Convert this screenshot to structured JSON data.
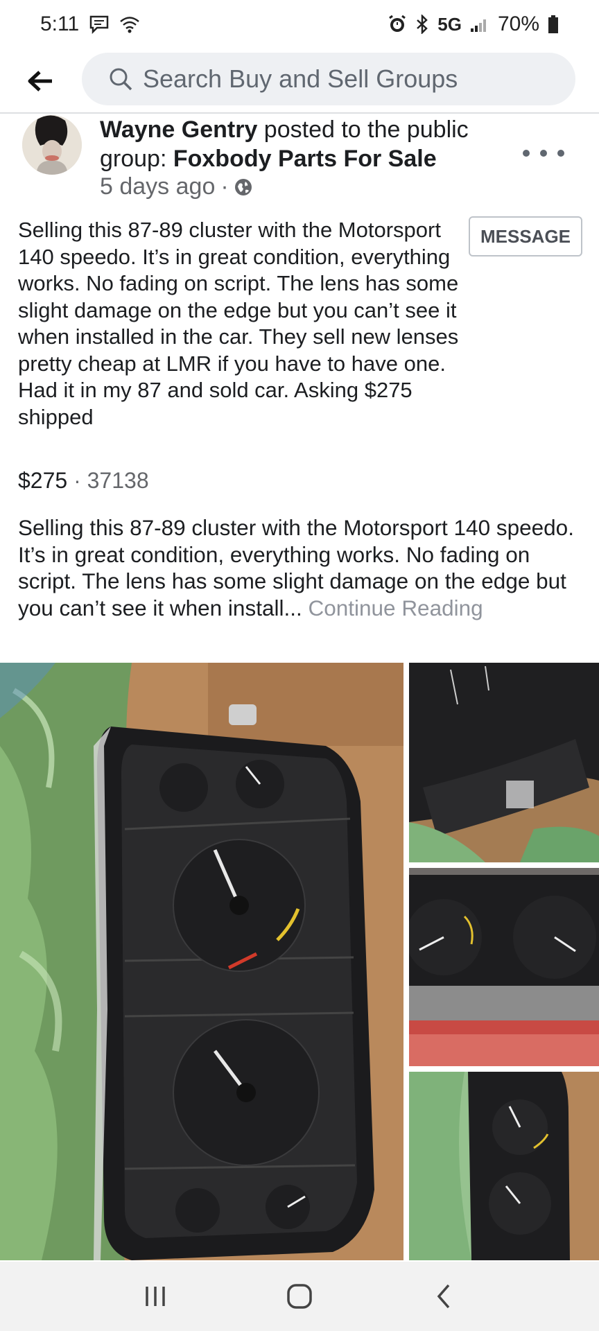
{
  "status_bar": {
    "time": "5:11",
    "network": "5G",
    "battery": "70%"
  },
  "search": {
    "placeholder": "Search Buy and Sell Groups"
  },
  "post": {
    "author": "Wayne Gentry",
    "action_text": " posted to the public group: ",
    "group": "Foxbody Parts For Sale",
    "time_ago": "5 days ago",
    "dot": "·",
    "message_button": "MESSAGE",
    "body": "Selling this 87-89 cluster with the Motorsport 140 speedo. It’s in great condition, everything works. No fading on script. The lens has some slight damage on the edge but you can’t see it when installed in the car. They sell new lenses pretty cheap at LMR if you have to have one. Had it in my 87 and sold car. Asking $275 shipped",
    "price": "$275",
    "price_sep": " · ",
    "zip": "37138",
    "description": "Selling this 87-89 cluster with the Motorsport 140 speedo. It’s in great condition, everything works. No fading on script. The lens has some slight damage on the edge but you can’t see it when install... ",
    "continue_label": "Continue Reading"
  },
  "icons": {
    "back": "back-arrow-icon",
    "search": "search-icon",
    "more": "more-icon",
    "globe": "globe-icon",
    "recents": "recents-icon",
    "home": "home-icon",
    "nav_back": "nav-back-icon"
  },
  "colors": {
    "search_bg": "#eef0f3",
    "muted_text": "#65676b",
    "continue_text": "#90949c"
  }
}
